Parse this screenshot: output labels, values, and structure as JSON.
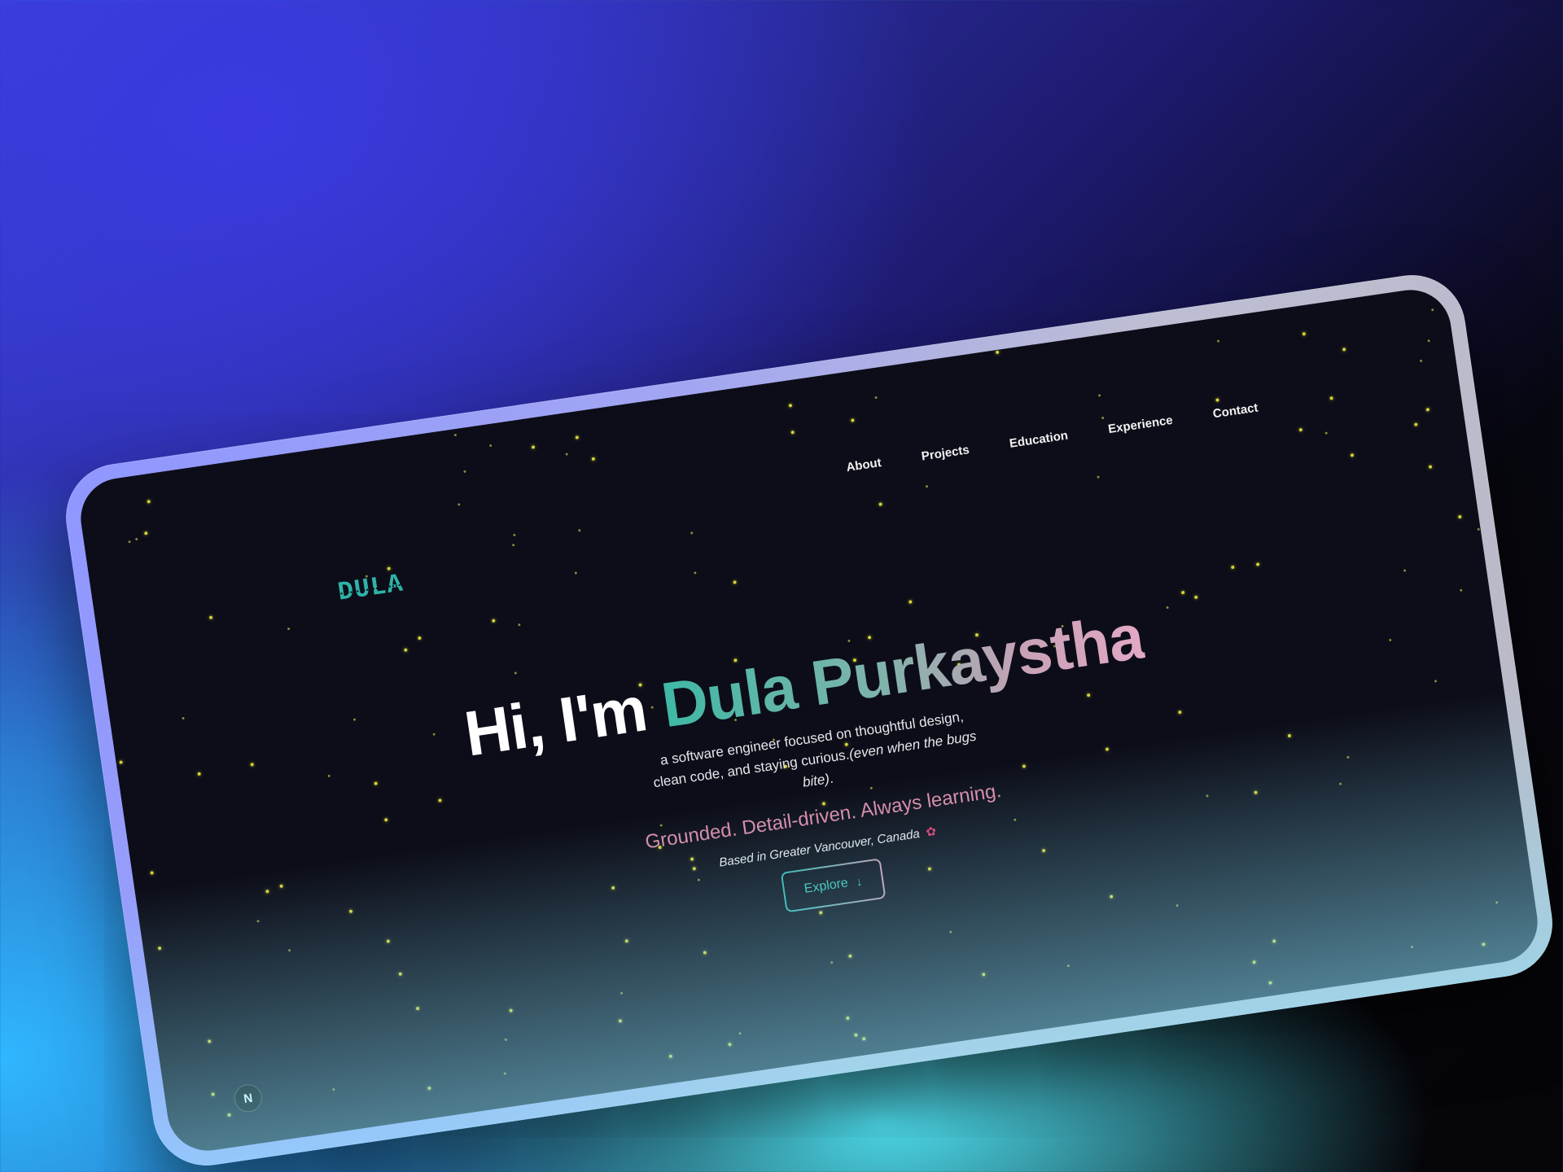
{
  "logo": {
    "text": "DULA"
  },
  "nav": {
    "items": [
      {
        "label": "About"
      },
      {
        "label": "Projects"
      },
      {
        "label": "Education"
      },
      {
        "label": "Experience"
      },
      {
        "label": "Contact"
      }
    ]
  },
  "hero": {
    "greeting": "Hi, I'm ",
    "name": "Dula Purkaystha",
    "tagline": "a software engineer focused on thoughtful design, clean code, and staying curious.",
    "tagline_aside": "(even when the bugs bite)",
    "tagline_end": ".",
    "motto": "Grounded. Detail-driven. Always learning.",
    "location": "Based in Greater Vancouver, Canada",
    "location_icon": "maple-leaf-icon",
    "cta": {
      "label": "Explore",
      "icon": "arrow-down-icon"
    }
  },
  "badge": {
    "text": "N",
    "icon": "nextjs-icon"
  },
  "colors": {
    "accent_teal": "#2fb3a8",
    "accent_pink": "#d98aa5",
    "screen_background": "#0c0d18",
    "star": "#d3d23a"
  }
}
